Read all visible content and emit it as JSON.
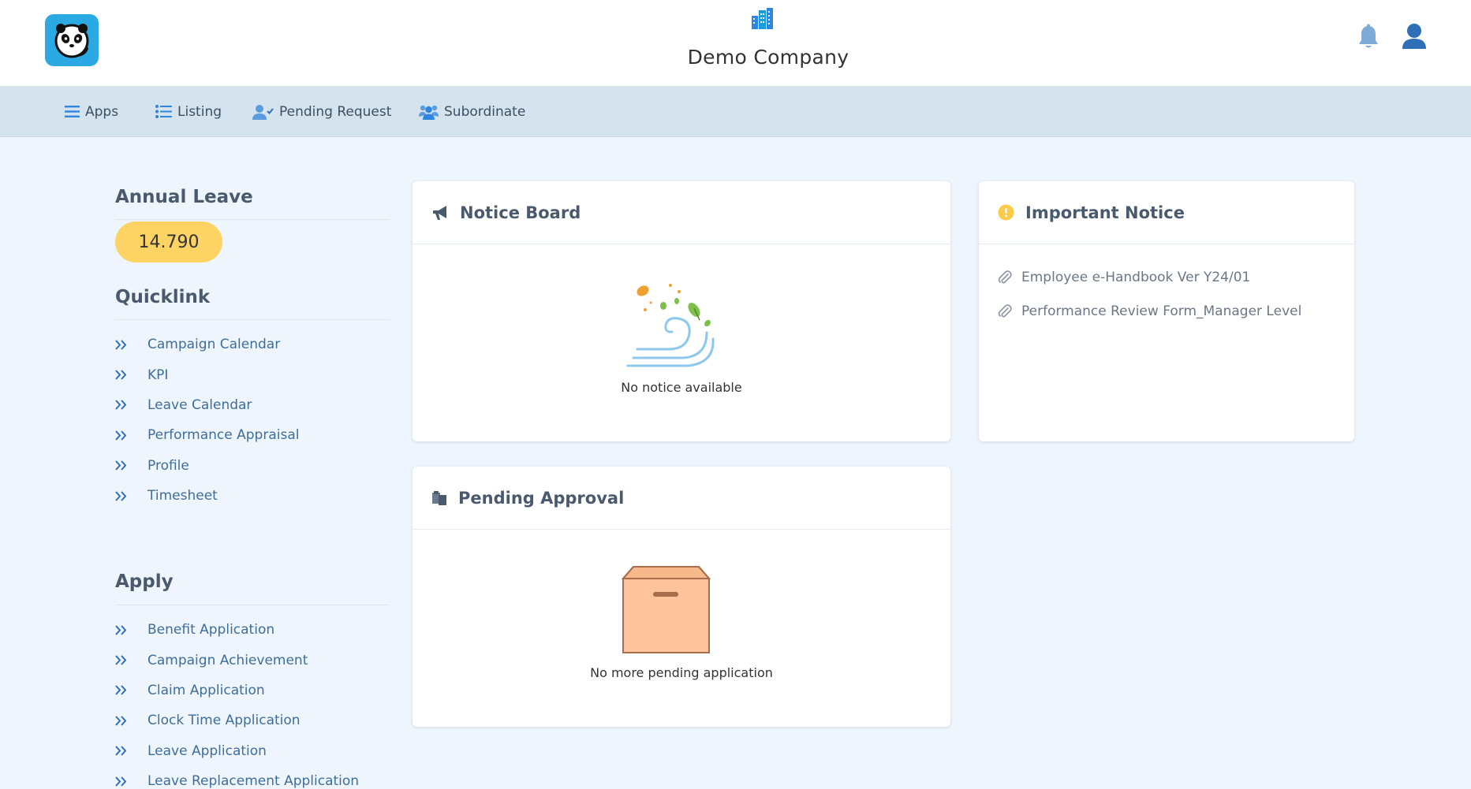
{
  "header": {
    "company_name": "Demo Company",
    "icons": [
      "panda-logo-icon",
      "building-icon",
      "bell-icon",
      "user-icon"
    ]
  },
  "nav": {
    "items": [
      {
        "label": "Apps",
        "icon": "menu-icon"
      },
      {
        "label": "Listing",
        "icon": "list-icon"
      },
      {
        "label": "Pending Request",
        "icon": "user-check-icon"
      },
      {
        "label": "Subordinate",
        "icon": "users-icon"
      }
    ]
  },
  "sidebar": {
    "annual_leave": {
      "title": "Annual Leave",
      "value": "14.790"
    },
    "quicklink": {
      "title": "Quicklink",
      "items": [
        "Campaign Calendar",
        "KPI",
        "Leave Calendar",
        "Performance Appraisal",
        "Profile",
        "Timesheet"
      ]
    },
    "apply": {
      "title": "Apply",
      "items": [
        "Benefit Application",
        "Campaign Achievement",
        "Claim Application",
        "Clock Time Application",
        "Leave Application",
        "Leave Replacement Application"
      ]
    }
  },
  "notice_board": {
    "title": "Notice Board",
    "empty_text": "No notice available"
  },
  "important_notice": {
    "title": "Important Notice",
    "items": [
      "Employee e-Handbook Ver Y24/01",
      "Performance Review Form_Manager Level"
    ]
  },
  "pending_approval": {
    "title": "Pending Approval",
    "empty_text": "No more pending application"
  },
  "colors": {
    "accent": "#2e86de",
    "nav_bg": "#d5e3ef",
    "page_bg": "#eef5fc",
    "badge": "#fdd464",
    "link": "#3f6e9a",
    "logo_bg": "#2ba9e3"
  }
}
